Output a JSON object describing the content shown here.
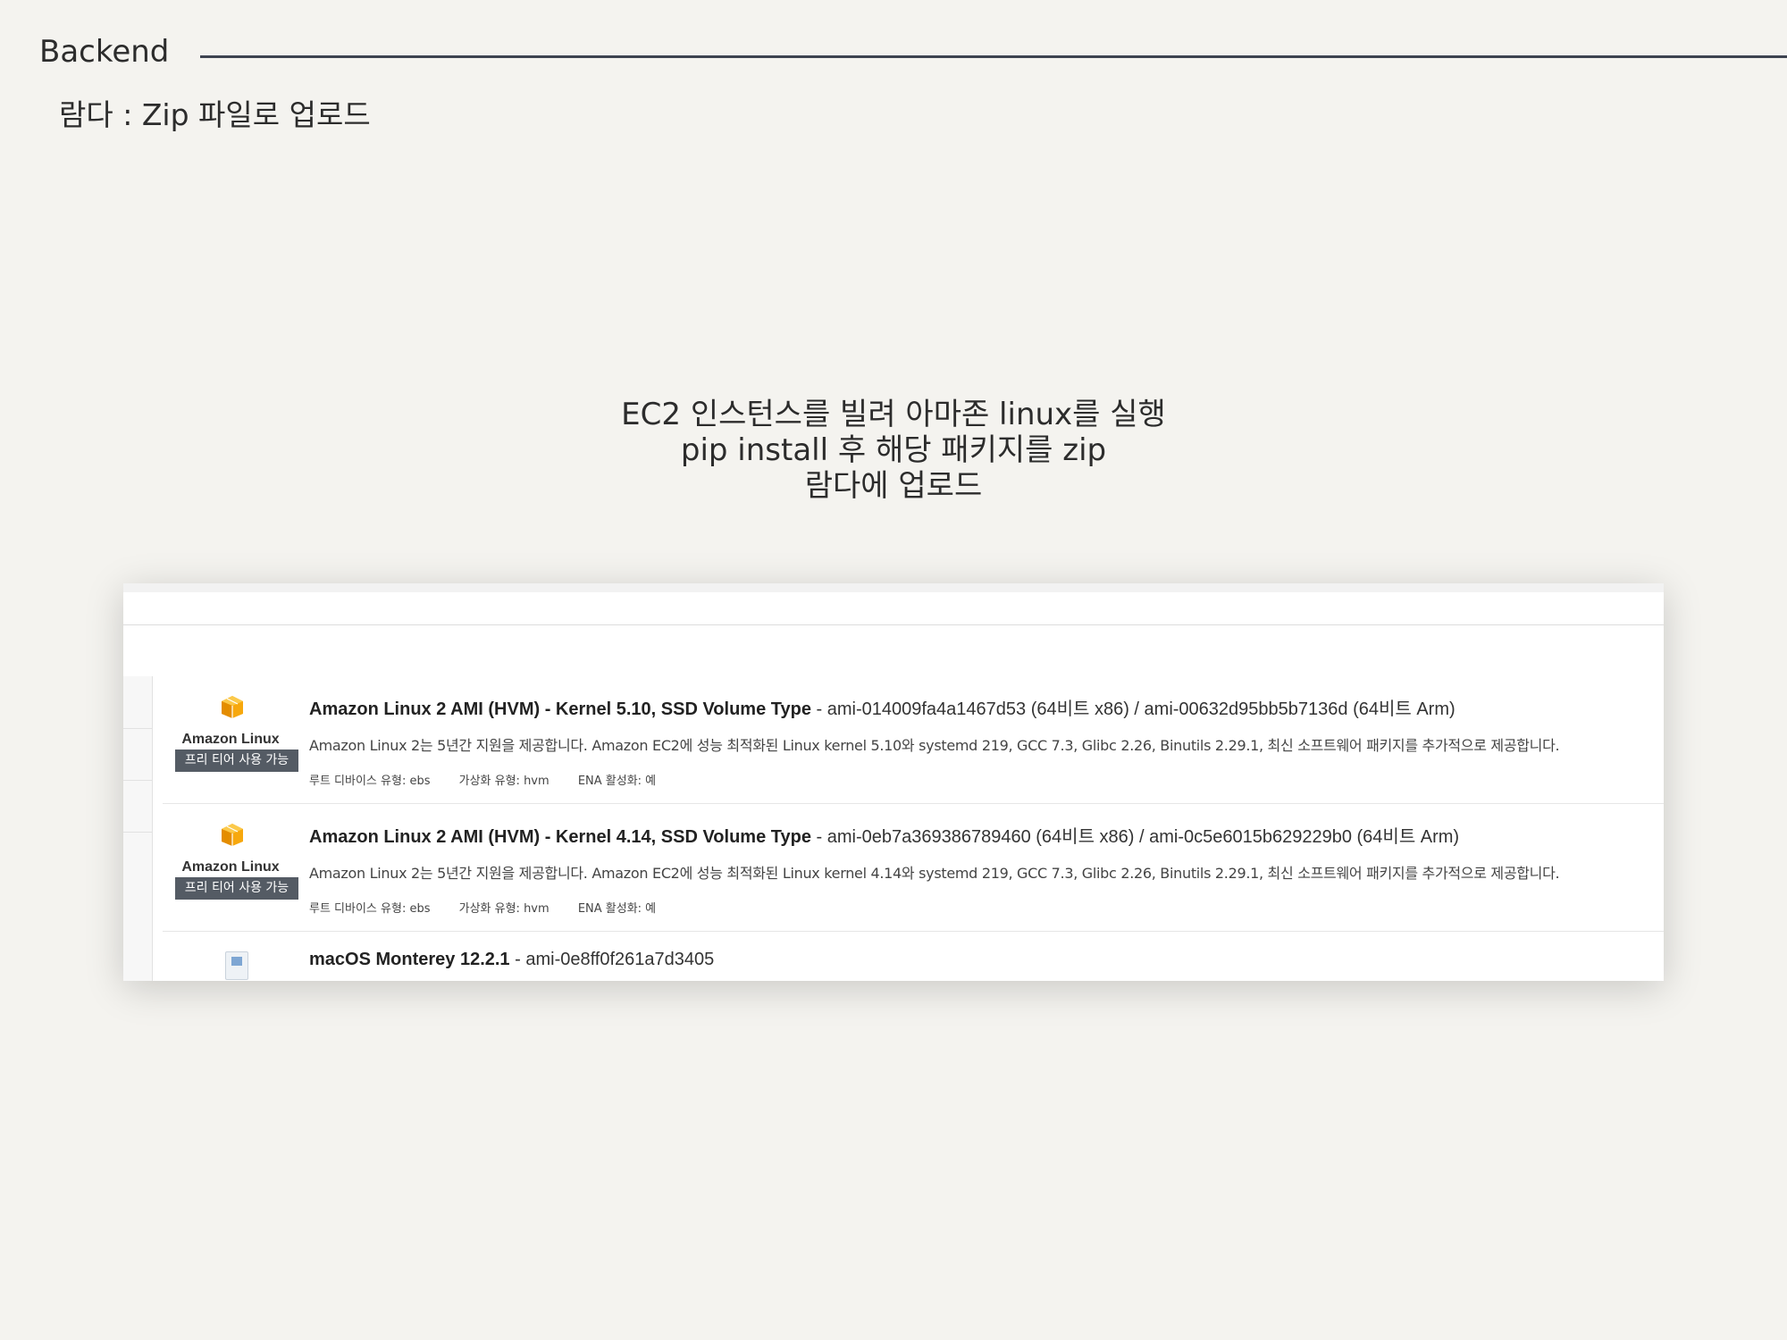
{
  "slide": {
    "section": "Backend",
    "subtitle": "람다 : Zip 파일로 업로드",
    "caption_lines": [
      "EC2 인스턴스를 빌려 아마존 linux를 실행",
      "pip install 후 해당 패키지를 zip",
      "람다에 업로드"
    ]
  },
  "ami_list": [
    {
      "icon": "amazon-linux-cube-icon",
      "vendor": "Amazon Linux",
      "badge": "프리 티어 사용 가능",
      "title": "Amazon Linux 2 AMI (HVM) - Kernel 5.10, SSD Volume Type",
      "ids": " - ami-014009fa4a1467d53 (64비트 x86) / ami-00632d95bb5b7136d (64비트 Arm)",
      "description": "Amazon Linux 2는 5년간 지원을 제공합니다. Amazon EC2에 성능 최적화된 Linux kernel 5.10와 systemd 219, GCC 7.3, Glibc 2.26, Binutils 2.29.1, 최신 소프트웨어 패키지를 추가적으로 제공합니다.",
      "root_device": "루트 디바이스 유형: ebs",
      "virtualization": "가상화 유형: hvm",
      "ena": "ENA 활성화: 예"
    },
    {
      "icon": "amazon-linux-cube-icon",
      "vendor": "Amazon Linux",
      "badge": "프리 티어 사용 가능",
      "title": "Amazon Linux 2 AMI (HVM) - Kernel 4.14, SSD Volume Type",
      "ids": " - ami-0eb7a369386789460 (64비트 x86) / ami-0c5e6015b629229b0 (64비트 Arm)",
      "description": "Amazon Linux 2는 5년간 지원을 제공합니다. Amazon EC2에 성능 최적화된 Linux kernel 4.14와 systemd 219, GCC 7.3, Glibc 2.26, Binutils 2.29.1, 최신 소프트웨어 패키지를 추가적으로 제공합니다.",
      "root_device": "루트 디바이스 유형: ebs",
      "virtualization": "가상화 유형: hvm",
      "ena": "ENA 활성화: 예"
    },
    {
      "icon": "macos-icon",
      "title": "macOS Monterey 12.2.1",
      "ids": " - ami-0e8ff0f261a7d3405"
    }
  ],
  "colors": {
    "background": "#f4f3ef",
    "rule": "#3d4350",
    "badge": "#545b64",
    "cube": "#f7a80d"
  }
}
